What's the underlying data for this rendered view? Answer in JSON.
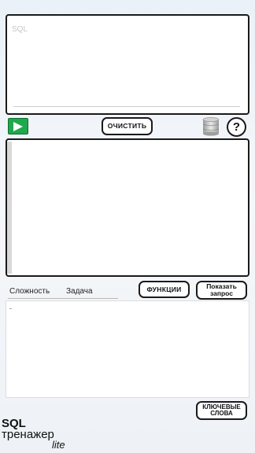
{
  "editor": {
    "placeholder": "SQL",
    "value": ""
  },
  "toolbar": {
    "run_icon": "play-icon",
    "clear_label": "ОЧИСТИТЬ",
    "database_icon": "database-icon",
    "help_label": "?"
  },
  "result": {
    "content": ""
  },
  "tabs": [
    {
      "label": "Сложность"
    },
    {
      "label": "Задача"
    }
  ],
  "buttons": {
    "functions_label": "ФУНКЦИИ",
    "show_query_label": "Показать запрос",
    "keywords_label": "КЛЮЧЕВЫЕ СЛОВА"
  },
  "task": {
    "text": "-"
  },
  "logo": {
    "line1": "SQL",
    "line2": "тренажер",
    "line3": "lite"
  },
  "colors": {
    "run_button": "#1fa84d",
    "border": "#1a1a1a"
  }
}
